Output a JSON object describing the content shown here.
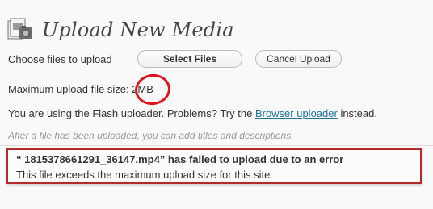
{
  "header": {
    "title": "Upload New Media",
    "icon": "media-icon"
  },
  "upload": {
    "choose_label": "Choose files to upload",
    "select_button": "Select Files",
    "cancel_button": "Cancel Upload",
    "max_size_label": "Maximum upload file size: ",
    "max_size_value": "2MB",
    "flash_notice_prefix": "You are using the Flash uploader. Problems? Try the ",
    "browser_uploader_link": "Browser uploader",
    "flash_notice_suffix": " instead.",
    "after_note": "After a file has been uploaded, you can add titles and descriptions."
  },
  "error": {
    "title": "“ 1815378661291_36147.mp4” has failed to upload due to an error",
    "message": "This file exceeds the maximum upload size for this site."
  },
  "colors": {
    "link": "#21759b",
    "annotation_red": "#e0141e",
    "error_border": "#b52a2a"
  }
}
